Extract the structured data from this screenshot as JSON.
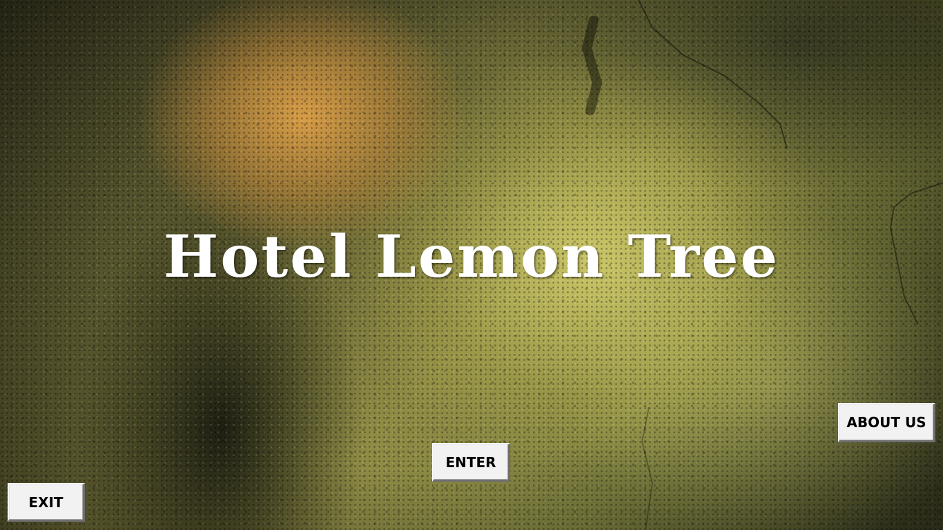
{
  "title": "Hotel Lemon Tree",
  "buttons": {
    "exit_label": "EXIT",
    "enter_label": "ENTER",
    "about_label": "ABOUT US"
  },
  "colors": {
    "title_text": "#ffffff",
    "button_face": "#f2f2f2",
    "button_text": "#000000"
  }
}
